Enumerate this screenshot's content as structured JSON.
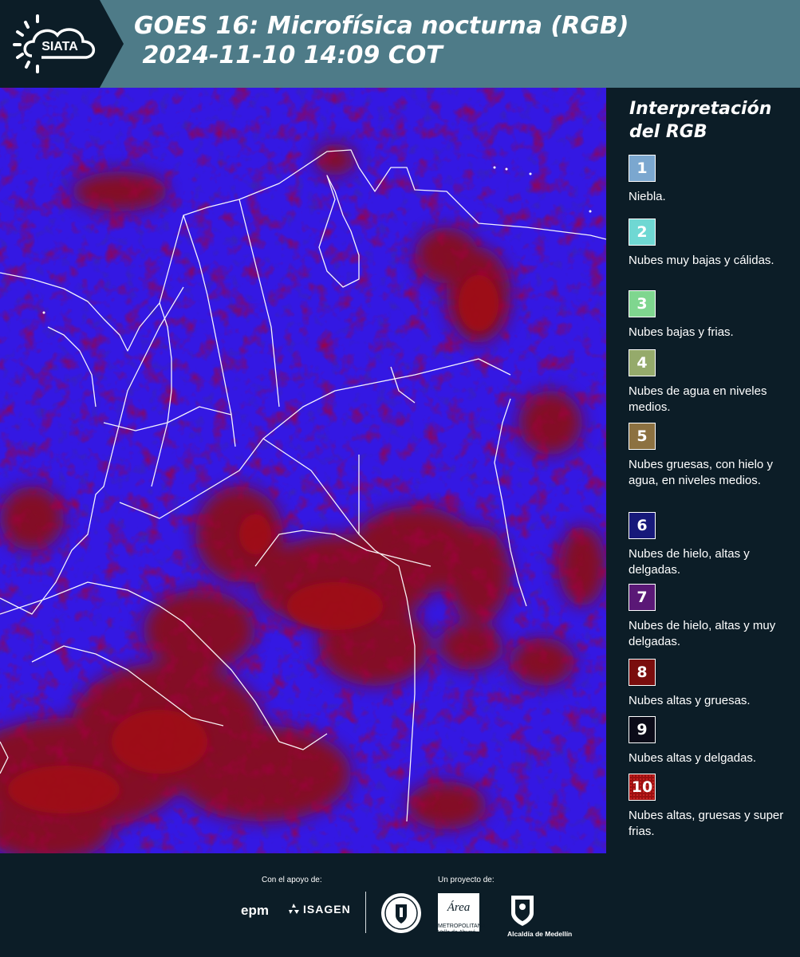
{
  "header": {
    "logo_text": "SIATA",
    "title_line1": "GOES 16: Microfísica nocturna (RGB)",
    "title_line2": " 2024-11-10 14:09 COT"
  },
  "legend": {
    "title_line1": "Interpretación",
    "title_line2": "del RGB",
    "items": [
      {
        "number": "1",
        "color": "#7ba7cf",
        "label": "Niebla."
      },
      {
        "number": "2",
        "color": "#6fd8d3",
        "label": "Nubes muy bajas y cálidas."
      },
      {
        "number": "3",
        "color": "#7fd68f",
        "label": "Nubes bajas y frias."
      },
      {
        "number": "4",
        "color": "#95aa6b",
        "label": "Nubes de agua en niveles medios."
      },
      {
        "number": "5",
        "color": "#8c7141",
        "label": "Nubes gruesas, con hielo y agua, en niveles medios."
      },
      {
        "number": "6",
        "color": "#17197a",
        "label": "Nubes de hielo, altas y delgadas."
      },
      {
        "number": "7",
        "color": "#5a1876",
        "label": "Nubes de hielo, altas y muy delgadas."
      },
      {
        "number": "8",
        "color": "#7a0d0d",
        "label": "Nubes altas y gruesas."
      },
      {
        "number": "9",
        "color": "#0b0b18",
        "label": "Nubes altas y delgadas."
      },
      {
        "number": "10",
        "color": "#9b1010",
        "label": "Nubes altas, gruesas y super frias."
      }
    ]
  },
  "footer": {
    "support_label": "Con el apoyo de:",
    "project_label": "Un proyecto de:",
    "sponsors": [
      "epm",
      "ISAGEN"
    ],
    "amva_name": "Área",
    "amva_sub": "METROPOLITANA",
    "amva_sub2": "Valle de Aburrá",
    "alcaldia": "Alcaldía de Medellín"
  },
  "colors": {
    "header_bg": "#4e7b88",
    "page_bg": "#0c1d27",
    "map_blue": "#3a1cf2",
    "map_red": "#8b0f12"
  }
}
